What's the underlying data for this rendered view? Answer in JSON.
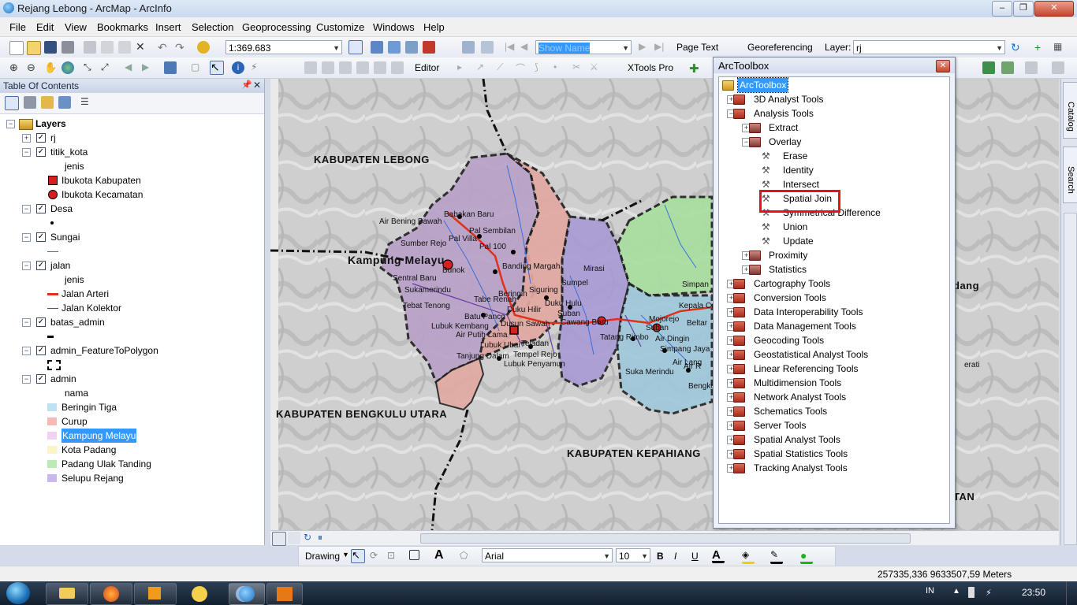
{
  "window": {
    "title": "Rejang Lebong - ArcMap - ArcInfo"
  },
  "menu": [
    "File",
    "Edit",
    "View",
    "Bookmarks",
    "Insert",
    "Selection",
    "Geoprocessing",
    "Customize",
    "Windows",
    "Help"
  ],
  "toolbar": {
    "scale": "1:369.683",
    "show_name": "Show Name",
    "page_text": "Page Text",
    "georeferencing": "Georeferencing",
    "layer_label": "Layer:",
    "layer_value": "rj",
    "editor": "Editor",
    "xtools": "XTools Pro"
  },
  "toc": {
    "title": "Table Of Contents",
    "root": "Layers",
    "layers": [
      {
        "name": "rj",
        "checked": true,
        "expanded": false
      },
      {
        "name": "titik_kota",
        "checked": true,
        "expanded": true,
        "field": "jenis",
        "legend": [
          {
            "label": "Ibukota Kabupaten",
            "symbol": "square-red"
          },
          {
            "label": "Ibukota Kecamatan",
            "symbol": "circle-red"
          }
        ]
      },
      {
        "name": "Desa",
        "checked": true,
        "expanded": true,
        "legend": [
          {
            "label": "",
            "symbol": "dot"
          }
        ]
      },
      {
        "name": "Sungai",
        "checked": true,
        "expanded": true,
        "legend": [
          {
            "label": "",
            "symbol": "blue-line"
          }
        ]
      },
      {
        "name": "jalan",
        "checked": true,
        "expanded": true,
        "field": "jenis",
        "legend": [
          {
            "label": "Jalan Arteri",
            "symbol": "red-line"
          },
          {
            "label": "Jalan Kolektor",
            "symbol": "purple-line"
          }
        ]
      },
      {
        "name": "batas_admin",
        "checked": true,
        "expanded": true,
        "legend": [
          {
            "label": "",
            "symbol": "dash"
          }
        ]
      },
      {
        "name": "admin_FeatureToPolygon",
        "checked": true,
        "expanded": true,
        "legend": [
          {
            "label": "",
            "symbol": "dashed-box"
          }
        ]
      },
      {
        "name": "admin",
        "checked": true,
        "expanded": true,
        "field": "nama",
        "legend": [
          {
            "label": "Beringin Tiga",
            "color": "#bfe2f2"
          },
          {
            "label": "Curup",
            "color": "#f6b9b5"
          },
          {
            "label": "Kampung Melayu",
            "color": "#f1d2f2",
            "selected": true
          },
          {
            "label": "Kota Padang",
            "color": "#fbf4c4"
          },
          {
            "label": "Padang Ulak Tanding",
            "color": "#b9ecb4"
          },
          {
            "label": "Selupu Rejang",
            "color": "#c8b8ef"
          }
        ]
      }
    ]
  },
  "map": {
    "region_labels": [
      "KABUPATEN LEBONG",
      "KABUPATEN BENGKULU UTARA",
      "KABUPATEN KEPAHIANG",
      "dang",
      "TAN"
    ],
    "place_labels": [
      "Babakan Baru",
      "Air Bening Bawah",
      "Pal Sembilan",
      "Sumber Rejo",
      "Pal Villa",
      "Pal 100",
      "Kampung Melayu",
      "Bunok",
      "Banding Margah",
      "Mirasi",
      "Sentral Baru",
      "Sukamerindu",
      "Sumpel",
      "Beringin",
      "Siguring",
      "Tebat Tenong",
      "Tabe Renah",
      "Batu Panco",
      "Duku Hilir",
      "Duku Hulu",
      "Suban",
      "Lubuk Kembang",
      "Air Putih Lama",
      "Dusun Sawah",
      "Cawang Baru",
      "Lubuk Ubai",
      "Teladan",
      "Tanjung Dalam",
      "Tempel Rejo",
      "Lubuk Penyamun",
      "Tatang Rimbo",
      "Suban",
      "Mojorejo",
      "Air Dingin",
      "Simpang Jaya",
      "Air Lang",
      "Suka Merindu",
      "Bengko",
      "Simpan",
      "Kepala Curup",
      "Beltar",
      "Air R",
      "erati"
    ],
    "city_label": "Kampung Melayu"
  },
  "arctoolbox": {
    "title": "ArcToolbox",
    "root": "ArcToolbox",
    "items": [
      {
        "label": "3D Analyst Tools",
        "level": 1,
        "kind": "toolbox",
        "expander": "+"
      },
      {
        "label": "Analysis Tools",
        "level": 1,
        "kind": "toolbox",
        "expander": "-"
      },
      {
        "label": "Extract",
        "level": 2,
        "kind": "toolset",
        "expander": "+"
      },
      {
        "label": "Overlay",
        "level": 2,
        "kind": "toolset",
        "expander": "-"
      },
      {
        "label": "Erase",
        "level": 3,
        "kind": "tool"
      },
      {
        "label": "Identity",
        "level": 3,
        "kind": "tool"
      },
      {
        "label": "Intersect",
        "level": 3,
        "kind": "tool",
        "highlighted": true
      },
      {
        "label": "Spatial Join",
        "level": 3,
        "kind": "tool"
      },
      {
        "label": "Symmetrical Difference",
        "level": 3,
        "kind": "tool"
      },
      {
        "label": "Union",
        "level": 3,
        "kind": "tool"
      },
      {
        "label": "Update",
        "level": 3,
        "kind": "tool"
      },
      {
        "label": "Proximity",
        "level": 2,
        "kind": "toolset",
        "expander": "+"
      },
      {
        "label": "Statistics",
        "level": 2,
        "kind": "toolset",
        "expander": "+"
      },
      {
        "label": "Cartography Tools",
        "level": 1,
        "kind": "toolbox",
        "expander": "+"
      },
      {
        "label": "Conversion Tools",
        "level": 1,
        "kind": "toolbox",
        "expander": "+"
      },
      {
        "label": "Data Interoperability Tools",
        "level": 1,
        "kind": "toolbox",
        "expander": "+"
      },
      {
        "label": "Data Management Tools",
        "level": 1,
        "kind": "toolbox",
        "expander": "+"
      },
      {
        "label": "Geocoding Tools",
        "level": 1,
        "kind": "toolbox",
        "expander": "+"
      },
      {
        "label": "Geostatistical Analyst Tools",
        "level": 1,
        "kind": "toolbox",
        "expander": "+"
      },
      {
        "label": "Linear Referencing Tools",
        "level": 1,
        "kind": "toolbox",
        "expander": "+"
      },
      {
        "label": "Multidimension Tools",
        "level": 1,
        "kind": "toolbox",
        "expander": "+"
      },
      {
        "label": "Network Analyst Tools",
        "level": 1,
        "kind": "toolbox",
        "expander": "+"
      },
      {
        "label": "Schematics Tools",
        "level": 1,
        "kind": "toolbox",
        "expander": "+"
      },
      {
        "label": "Server Tools",
        "level": 1,
        "kind": "toolbox",
        "expander": "+"
      },
      {
        "label": "Spatial Analyst Tools",
        "level": 1,
        "kind": "toolbox",
        "expander": "+"
      },
      {
        "label": "Spatial Statistics Tools",
        "level": 1,
        "kind": "toolbox",
        "expander": "+"
      },
      {
        "label": "Tracking Analyst Tools",
        "level": 1,
        "kind": "toolbox",
        "expander": "+"
      }
    ]
  },
  "side_tabs": [
    "Catalog",
    "Search"
  ],
  "drawing": {
    "label": "Drawing",
    "font": "Arial",
    "size": "10",
    "bold": "B",
    "italic": "I",
    "underline": "U"
  },
  "status": {
    "coordinates": "257335,336  9633507,59 Meters"
  },
  "taskbar": {
    "lang": "IN",
    "time": "23:50"
  },
  "colors": {
    "accent": "#3399ff",
    "highlight_box": "#e0141b",
    "arteri": "#e0301a"
  }
}
